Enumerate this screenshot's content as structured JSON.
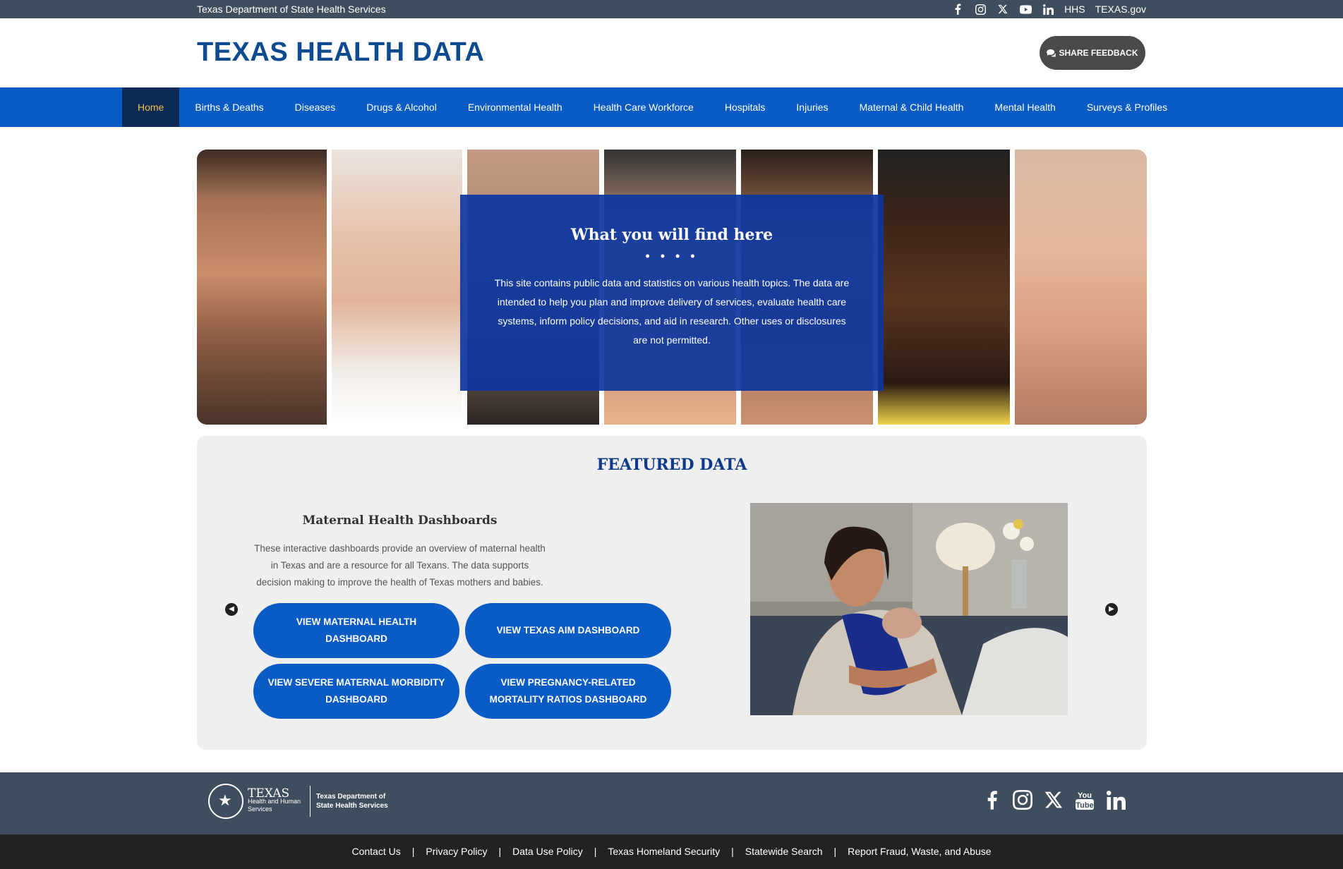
{
  "topbar": {
    "agency": "Texas Department of State Health Services",
    "icons": [
      "facebook-icon",
      "instagram-icon",
      "x-icon",
      "youtube-icon",
      "linkedin-icon"
    ],
    "links": [
      "HHS",
      "TEXAS.gov"
    ]
  },
  "header": {
    "title": "TEXAS HEALTH DATA",
    "feedback_label": "SHARE FEEDBACK"
  },
  "nav": {
    "items": [
      "Home",
      "Births & Deaths",
      "Diseases",
      "Drugs & Alcohol",
      "Environmental Health",
      "Health Care Workforce",
      "Hospitals",
      "Injuries",
      "Maternal & Child Health",
      "Mental Health",
      "Surveys & Profiles"
    ],
    "active": "Home"
  },
  "hero": {
    "title": "What you will find here",
    "dots": "• • • •",
    "text": "This site contains public data and statistics on various health topics. The data are intended to help you plan and improve delivery of services, evaluate health care systems, inform policy decisions, and aid in research. Other uses or disclosures are not permitted."
  },
  "featured": {
    "title": "FEATURED DATA",
    "card_title": "Maternal Health Dashboards",
    "card_desc": "These interactive dashboards provide an overview of maternal health in Texas and are a resource for all Texans. The data supports decision making to improve the health of Texas mothers and babies.",
    "buttons": [
      "VIEW MATERNAL HEALTH DASHBOARD",
      "VIEW TEXAS AIM DASHBOARD",
      "VIEW SEVERE MATERNAL MORBIDITY DASHBOARD",
      "VIEW PREGNANCY-RELATED MORTALITY RATIOS DASHBOARD"
    ]
  },
  "footer": {
    "logo_texas": "TEXAS",
    "logo_hhs": "Health and Human Services",
    "logo_dshs": "Texas Department of State Health Services",
    "social_icons": [
      "facebook-icon",
      "instagram-icon",
      "x-icon",
      "youtube-icon",
      "linkedin-icon"
    ],
    "links": [
      "Contact Us",
      "Privacy Policy",
      "Data Use Policy",
      "Texas Homeland Security",
      "Statewide Search",
      "Report Fraud, Waste, and Abuse"
    ]
  }
}
